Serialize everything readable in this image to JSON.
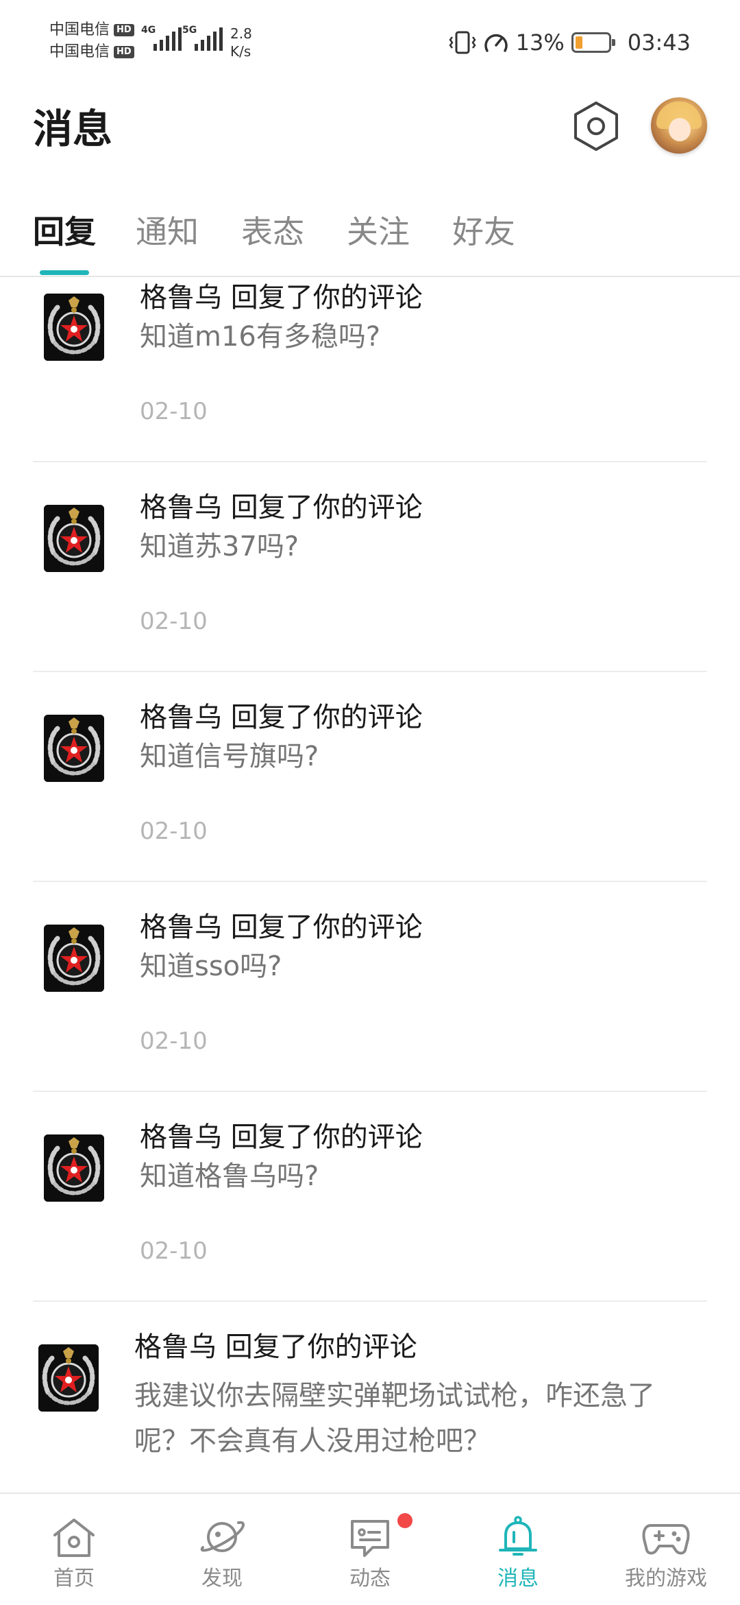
{
  "status_bar": {
    "carrier1": "中国电信",
    "carrier2": "中国电信",
    "hd": "HD",
    "net1": "4G",
    "net2": "5G",
    "speed_value": "2.8",
    "speed_unit": "K/s",
    "battery_percent": "13%",
    "time": "03:43",
    "battery_level": 0.13
  },
  "header": {
    "title": "消息"
  },
  "tabs": [
    {
      "label": "回复",
      "active": true
    },
    {
      "label": "通知",
      "active": false
    },
    {
      "label": "表态",
      "active": false
    },
    {
      "label": "关注",
      "active": false
    },
    {
      "label": "好友",
      "active": false
    }
  ],
  "replies": [
    {
      "user": "格鲁乌",
      "action": "回复了你的评论",
      "title": "格鲁乌 回复了你的评论",
      "text": "知道m16有多稳吗?",
      "date": "02-10"
    },
    {
      "user": "格鲁乌",
      "action": "回复了你的评论",
      "title": "格鲁乌 回复了你的评论",
      "text": "知道苏37吗?",
      "date": "02-10"
    },
    {
      "user": "格鲁乌",
      "action": "回复了你的评论",
      "title": "格鲁乌 回复了你的评论",
      "text": "知道信号旗吗?",
      "date": "02-10"
    },
    {
      "user": "格鲁乌",
      "action": "回复了你的评论",
      "title": "格鲁乌 回复了你的评论",
      "text": "知道sso吗?",
      "date": "02-10"
    },
    {
      "user": "格鲁乌",
      "action": "回复了你的评论",
      "title": "格鲁乌 回复了你的评论",
      "text": "知道格鲁乌吗?",
      "date": "02-10"
    },
    {
      "user": "格鲁乌",
      "action": "回复了你的评论",
      "title": "格鲁乌 回复了你的评论",
      "text": "我建议你去隔壁实弹靶场试试枪，咋还急了呢？不会真有人没用过枪吧？",
      "date": ""
    }
  ],
  "bottom_nav": [
    {
      "label": "首页",
      "icon": "home-icon",
      "active": false
    },
    {
      "label": "发现",
      "icon": "planet-icon",
      "active": false
    },
    {
      "label": "动态",
      "icon": "chat-icon",
      "active": false,
      "badge": true
    },
    {
      "label": "消息",
      "icon": "bell-icon",
      "active": true
    },
    {
      "label": "我的游戏",
      "icon": "gamepad-icon",
      "active": false
    }
  ],
  "colors": {
    "accent": "#1fb5b8",
    "badge": "#f24848",
    "battery_low": "#f0a030"
  }
}
